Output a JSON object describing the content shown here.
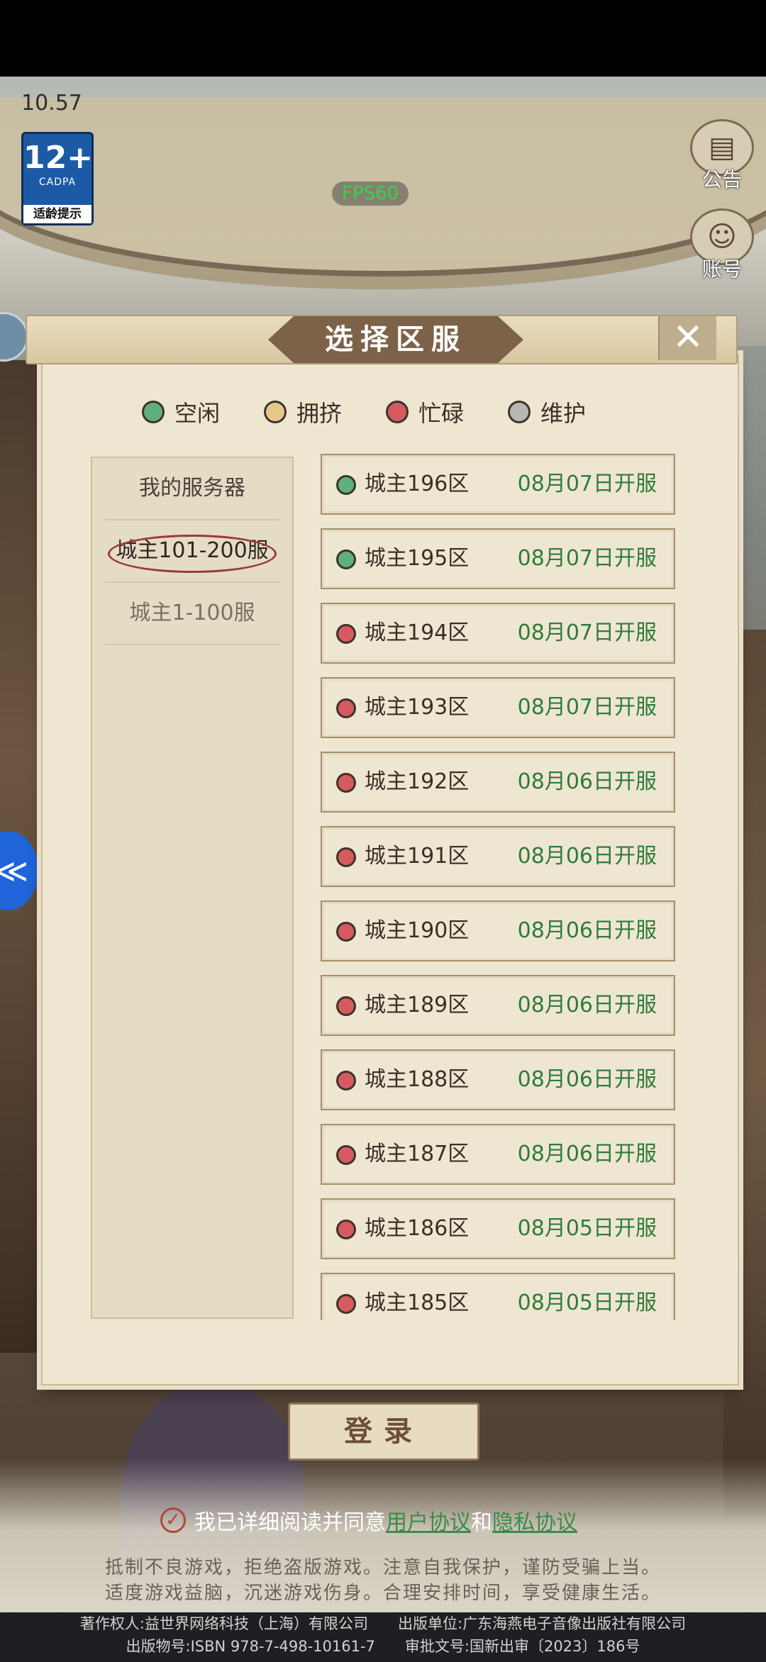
{
  "status_bar": {
    "time": "10.57"
  },
  "age_badge": {
    "number": "12+",
    "org": "CADPA",
    "caption": "适龄提示"
  },
  "fps": "FPS60",
  "right_buttons": {
    "announce": "公告",
    "account": "账号"
  },
  "dialog": {
    "title": "选择区服",
    "legend": [
      {
        "label": "空闲",
        "color": "green"
      },
      {
        "label": "拥挤",
        "color": "yellow"
      },
      {
        "label": "忙碌",
        "color": "red"
      },
      {
        "label": "维护",
        "color": "gray"
      }
    ],
    "sidebar": {
      "mine": "我的服务器",
      "group_selected": "城主101-200服",
      "group_other": "城主1-100服"
    },
    "servers": [
      {
        "name": "城主196区",
        "date": "08月07日开服",
        "status": "green"
      },
      {
        "name": "城主195区",
        "date": "08月07日开服",
        "status": "green"
      },
      {
        "name": "城主194区",
        "date": "08月07日开服",
        "status": "red"
      },
      {
        "name": "城主193区",
        "date": "08月07日开服",
        "status": "red"
      },
      {
        "name": "城主192区",
        "date": "08月06日开服",
        "status": "red"
      },
      {
        "name": "城主191区",
        "date": "08月06日开服",
        "status": "red"
      },
      {
        "name": "城主190区",
        "date": "08月06日开服",
        "status": "red"
      },
      {
        "name": "城主189区",
        "date": "08月06日开服",
        "status": "red"
      },
      {
        "name": "城主188区",
        "date": "08月06日开服",
        "status": "red"
      },
      {
        "name": "城主187区",
        "date": "08月06日开服",
        "status": "red"
      },
      {
        "name": "城主186区",
        "date": "08月05日开服",
        "status": "red"
      },
      {
        "name": "城主185区",
        "date": "08月05日开服",
        "status": "red"
      }
    ]
  },
  "login_button": "登录",
  "agreement": {
    "prefix": "我已详细阅读并同意",
    "user_link": "用户协议",
    "and": "和",
    "privacy_link": "隐私协议"
  },
  "notice": [
    "抵制不良游戏，拒绝盗版游戏。注意自我保护，谨防受骗上当。",
    "适度游戏益脑，沉迷游戏伤身。合理安排时间，享受健康生活。"
  ],
  "footer": [
    "著作权人:益世界网络科技（上海）有限公司　　出版单位:广东海燕电子音像出版社有限公司",
    "出版物号:ISBN 978-7-498-10161-7　　审批文号:国新出审〔2023〕186号"
  ]
}
